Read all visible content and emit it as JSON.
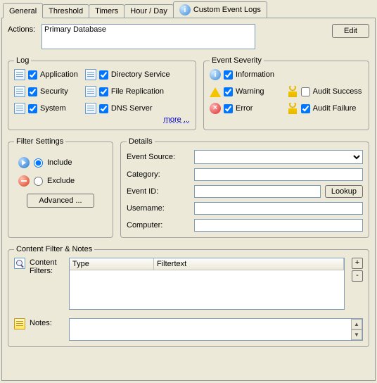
{
  "tabs": {
    "general": "General",
    "threshold": "Threshold",
    "timers": "Timers",
    "hourday": "Hour / Day",
    "custom": "Custom Event Logs"
  },
  "actions": {
    "label": "Actions:",
    "value": "Primary Database",
    "edit": "Edit"
  },
  "log": {
    "title": "Log",
    "items": {
      "application": "Application",
      "security": "Security",
      "system": "System",
      "directory": "Directory Service",
      "filerep": "File Replication",
      "dns": "DNS Server"
    },
    "more": "more ..."
  },
  "severity": {
    "title": "Event Severity",
    "info": "Information",
    "warn": "Warning",
    "err": "Error",
    "succ": "Audit Success",
    "fail": "Audit Failure"
  },
  "filter": {
    "title": "Filter Settings",
    "include": "Include",
    "exclude": "Exclude",
    "advanced": "Advanced ..."
  },
  "details": {
    "title": "Details",
    "source": "Event Source:",
    "category": "Category:",
    "eventid": "Event ID:",
    "username": "Username:",
    "computer": "Computer:",
    "lookup": "Lookup"
  },
  "content": {
    "title": "Content Filter & Notes",
    "filters_lbl": "Content Filters:",
    "col_type": "Type",
    "col_text": "Filtertext",
    "notes_lbl": "Notes:"
  }
}
